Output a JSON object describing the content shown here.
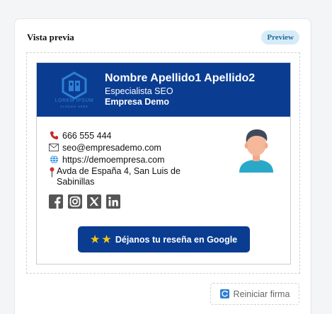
{
  "panel": {
    "title": "Vista previa",
    "badge": "Preview"
  },
  "signature": {
    "logo": {
      "text": "LOREM IPSUM",
      "subtext": "SLOGAN HERE",
      "color": "#2f7fd6"
    },
    "name": "Nombre Apellido1 Apellido2",
    "role": "Especialista SEO",
    "company": "Empresa Demo",
    "header_color": "#0a3d91",
    "contact": {
      "phone": "666 555 444",
      "email": "seo@empresademo.com",
      "website": "https://demoempresa.com",
      "address": "Avda de España 4, San Luis de Sabinillas"
    },
    "socials": [
      {
        "icon": "facebook-icon"
      },
      {
        "icon": "instagram-icon"
      },
      {
        "icon": "x-icon"
      },
      {
        "icon": "linkedin-icon"
      }
    ],
    "review_button": {
      "stars": "★ ★",
      "label": "Déjanos tu reseña en Google"
    }
  },
  "actions": {
    "reset_label": "Reiniciar firma"
  }
}
